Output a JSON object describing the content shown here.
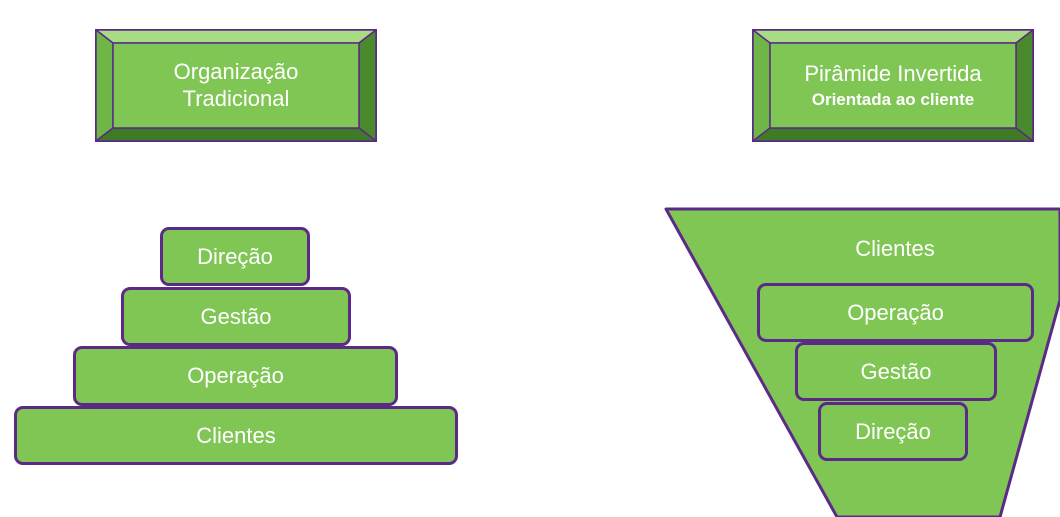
{
  "left": {
    "title_line1": "Organização",
    "title_line2": "Tradicional",
    "layers": [
      "Direção",
      "Gestão",
      "Operação",
      "Clientes"
    ]
  },
  "right": {
    "title_line1": "Pirâmide Invertida",
    "title_line2": "Orientada ao cliente",
    "top_label": "Clientes",
    "layers": [
      "Operação",
      "Gestão",
      "Direção"
    ]
  },
  "colors": {
    "fill": "#80c654",
    "outline": "#5b2a86",
    "bevel_dark": "#4a8a2c",
    "bevel_light": "#a8dc84",
    "text": "#ffffff"
  }
}
